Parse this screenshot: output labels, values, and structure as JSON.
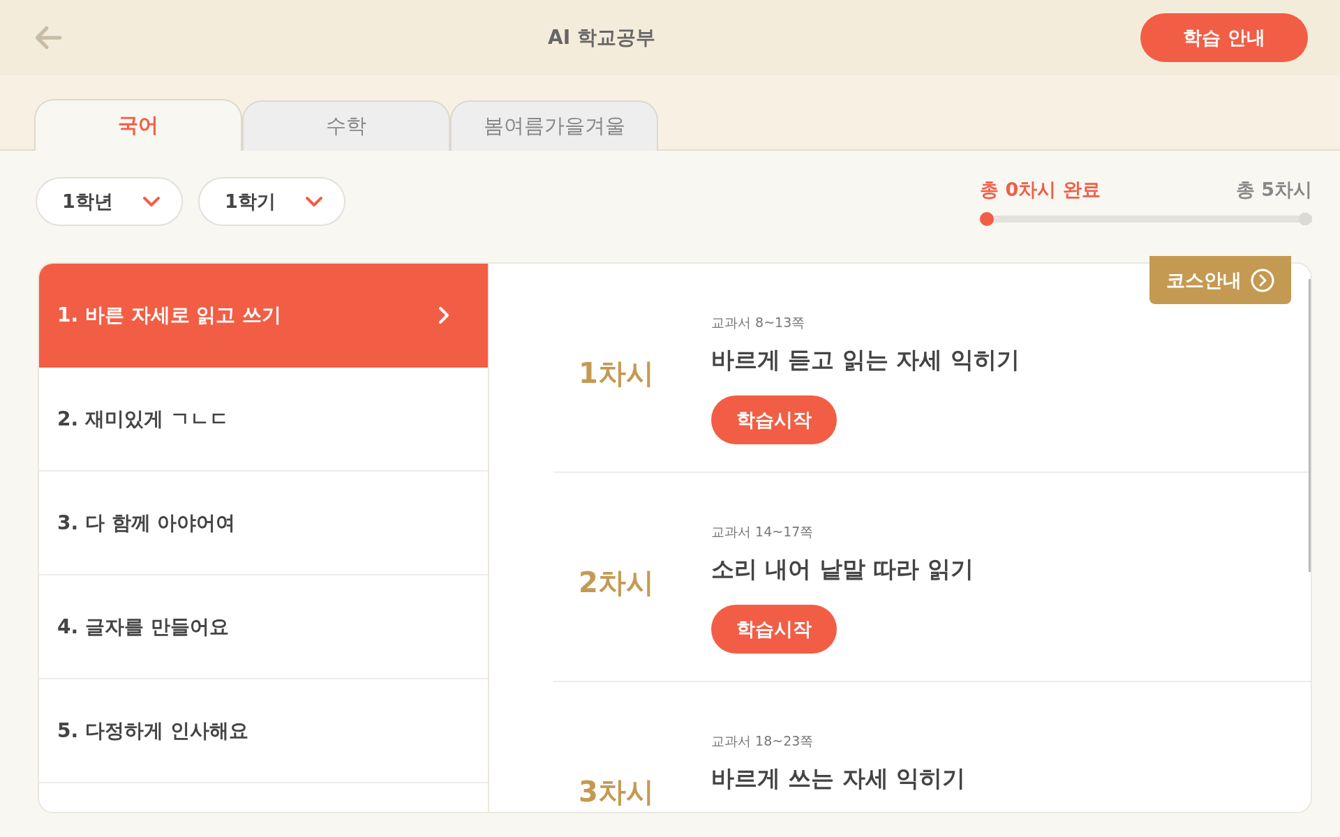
{
  "header": {
    "title": "AI 학교공부",
    "guide_button": "학습 안내"
  },
  "tabs": [
    {
      "label": "국어",
      "selected": true
    },
    {
      "label": "수학",
      "selected": false
    },
    {
      "label": "봄여름가을겨울",
      "selected": false
    }
  ],
  "filters": [
    {
      "value": "1학년"
    },
    {
      "value": "1학기"
    }
  ],
  "progress": {
    "done_label": "총 0차시 완료",
    "total_label": "총 5차시",
    "level": 0
  },
  "units": [
    {
      "label": "1. 바른 자세로 읽고 쓰기",
      "selected": true
    },
    {
      "label": "2. 재미있게 ㄱㄴㄷ",
      "selected": false
    },
    {
      "label": "3. 다 함께 아야어여",
      "selected": false
    },
    {
      "label": "4. 글자를 만들어요",
      "selected": false
    },
    {
      "label": "5. 다정하게 인사해요",
      "selected": false
    }
  ],
  "course_guide": "코스안내",
  "lessons": [
    {
      "number": "1차시",
      "pages": "교과서 8~13쪽",
      "title": "바르게 듣고 읽는 자세 익히기",
      "button": "학습시작"
    },
    {
      "number": "2차시",
      "pages": "교과서 14~17쪽",
      "title": "소리 내어 낱말 따라 읽기",
      "button": "학습시작"
    },
    {
      "number": "3차시",
      "pages": "교과서 18~23쪽",
      "title": "바르게 쓰는 자세 익히기"
    }
  ]
}
